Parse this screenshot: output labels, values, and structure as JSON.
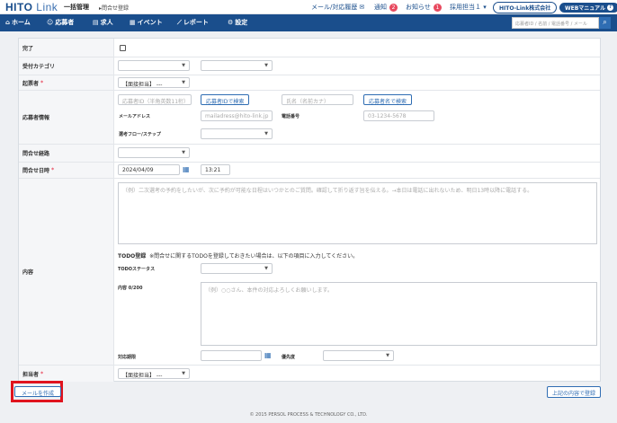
{
  "header": {
    "logo_main": "HITO",
    "logo_sub": "Link",
    "title": "一括管理",
    "breadcrumb": "▸問合せ登録",
    "mail_history": "メール/対応履歴",
    "notice_label": "通知",
    "notice_count": "2",
    "info_label": "お知らせ",
    "info_count": "1",
    "user_label": "採用担当１ ▾",
    "company_label": "HITO-Link株式会社",
    "manual_label": "WEBマニュアル"
  },
  "nav": {
    "items": [
      {
        "label": "ホーム",
        "icon": "home-icon"
      },
      {
        "label": "応募者",
        "icon": "people-icon"
      },
      {
        "label": "求人",
        "icon": "book-icon"
      },
      {
        "label": "イベント",
        "icon": "calendar-icon"
      },
      {
        "label": "レポート",
        "icon": "chart-icon"
      },
      {
        "label": "設定",
        "icon": "gear-icon"
      }
    ],
    "search_placeholder": "応募者ID / 名前 / 電話番号 / メール"
  },
  "form": {
    "complete_label": "完了",
    "category_label": "受付カテゴリ",
    "drafter_label": "起票者",
    "drafter_value": "【面接担当】 ---",
    "applicant_info_label": "応募者情報",
    "applicant_id_placeholder": "応募者ID（半角英数11桁）",
    "search_by_id_button": "応募者IDで検索",
    "name_placeholder": "氏名（名前カナ）",
    "search_by_name_button": "応募者名で検索",
    "email_label": "メールアドレス",
    "email_placeholder": "mailadress@hito-link.jp",
    "phone_label": "電話番号",
    "phone_placeholder": "03-1234-5678",
    "flow_label": "選考フロー/ステップ",
    "route_label": "問合せ経路",
    "datetime_label": "問合せ日時",
    "date_value": "2024/04/09",
    "time_value": "13:21",
    "content_label": "内容",
    "content_placeholder": "（例）二次選考の予約をしたいが、次に予約が可能な日程はいつかとのご質問。確認して折り返す旨を伝える。→本日は電話に出れないため、明日13時以降に電話する。",
    "todo_heading": "TODO登録",
    "todo_note": "※問合せに関するTODOを登録しておきたい場合は、以下の項目に入力してください。",
    "todo_status_label": "TODOステータス",
    "todo_content_label": "内容 0/200",
    "todo_content_placeholder": "（例）○○さん、本件の対応よろしくお願いします。",
    "due_label": "対応期限",
    "priority_label": "優先度",
    "assignee_label": "担当者",
    "assignee_value": "【面接担当】 ---"
  },
  "footer": {
    "create_mail_button": "メールを作成",
    "register_button": "上記の内容で登録",
    "copyright": "© 2015 PERSOL PROCESS & TECHNOLOGY CO., LTD."
  },
  "colors": {
    "brand": "#1a4e8c",
    "accent": "#2f6db3",
    "badge": "#e84a5f",
    "highlight": "#e0141e"
  }
}
